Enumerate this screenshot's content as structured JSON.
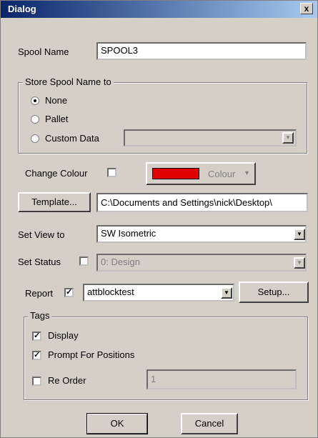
{
  "window": {
    "title": "Dialog",
    "close_glyph": "x"
  },
  "spool_name": {
    "label": "Spool Name",
    "value": "SPOOL3"
  },
  "store_group": {
    "title": "Store Spool Name to",
    "options": [
      "None",
      "Pallet",
      "Custom Data"
    ],
    "selected": "None",
    "custom_data_value": ""
  },
  "change_colour": {
    "label": "Change Colour",
    "checked": false,
    "button_label": "Colour",
    "color": "#e00000"
  },
  "template": {
    "button_label": "Template...",
    "path": "C:\\Documents and Settings\\nick\\Desktop\\"
  },
  "set_view": {
    "label": "Set View to",
    "value": "SW Isometric"
  },
  "set_status": {
    "label": "Set Status",
    "checked": false,
    "value": "0: Design"
  },
  "report": {
    "label": "Report",
    "checked": true,
    "value": "attblocktest",
    "setup_label": "Setup..."
  },
  "tags": {
    "title": "Tags",
    "display_label": "Display",
    "display_checked": true,
    "prompt_label": "Prompt For Positions",
    "prompt_checked": true,
    "reorder_label": "Re Order",
    "reorder_checked": false,
    "reorder_value": "1"
  },
  "buttons": {
    "ok": "OK",
    "cancel": "Cancel"
  },
  "icons": {
    "dropdown": "chevron-down-icon",
    "close": "close-icon",
    "check": "checkmark-icon"
  }
}
